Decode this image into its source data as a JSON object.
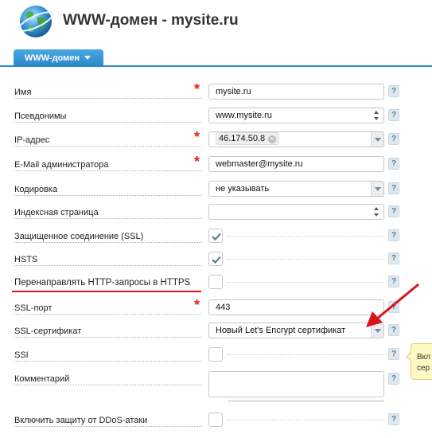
{
  "header": {
    "title": "WWW-домен - mysite.ru"
  },
  "tabs": [
    {
      "label": "WWW-домен"
    }
  ],
  "form": {
    "name": {
      "label": "Имя",
      "value": "mysite.ru"
    },
    "aliases": {
      "label": "Псевдонимы",
      "value": "www.mysite.ru"
    },
    "ip": {
      "label": "IP-адрес",
      "value": "46.174.50.8"
    },
    "email": {
      "label": "E-Mail администратора",
      "value": "webmaster@mysite.ru"
    },
    "charset": {
      "label": "Кодировка",
      "value": "не указывать"
    },
    "index": {
      "label": "Индексная страница",
      "value": ""
    },
    "ssl": {
      "label": "Защищенное соединение (SSL)",
      "checked": true
    },
    "hsts": {
      "label": "HSTS",
      "checked": true
    },
    "redirect": {
      "label": "Перенаправлять HTTP-запросы в HTTPS",
      "checked": false
    },
    "ssl_port": {
      "label": "SSL-порт",
      "value": "443"
    },
    "ssl_cert": {
      "label": "SSL-сертификат",
      "value": "Новый Let's Encrypt сертификат"
    },
    "ssi": {
      "label": "SSI",
      "checked": false
    },
    "comment": {
      "label": "Комментарий",
      "value": ""
    },
    "ddos": {
      "label": "Включить защиту от DDoS-атаки",
      "checked": false
    }
  },
  "help_label": "?",
  "required_mark": "*",
  "tooltip": {
    "line1": "Вкл",
    "line2": "сер"
  },
  "colors": {
    "accent": "#2e8fd0",
    "required": "#e2231a",
    "annotation": "#d8131b",
    "tooltip_bg": "#fff8c4"
  },
  "icons": {
    "logo": "globe-icon",
    "check": "check-icon",
    "remove": "remove-chip-icon",
    "dropdown": "chevron-down-icon",
    "spinner": "spinner-icon",
    "help": "help-icon"
  }
}
